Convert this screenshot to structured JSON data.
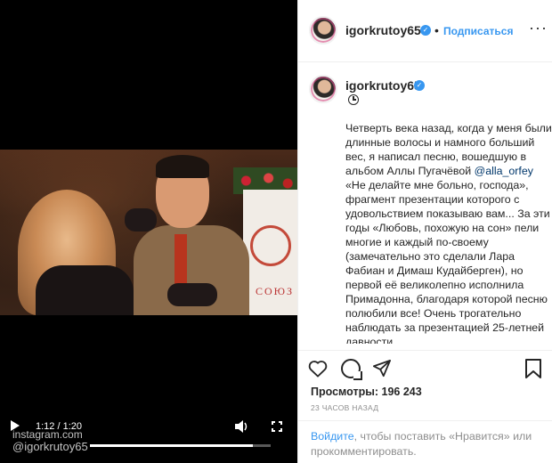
{
  "video": {
    "time_label": "1:12 / 1:20",
    "progress": 0.9,
    "watermark_site": "instagram.com",
    "watermark_handle": "@igorkrutoy65",
    "banner_text": "СОЮЗ"
  },
  "header": {
    "username": "igorkrutoy65",
    "separator": "•",
    "follow_label": "Подписаться",
    "more_label": "···"
  },
  "comment": {
    "username": "igorkrutoy65",
    "caption_before": "Четверть века назад, когда у меня были длинные волосы и намного больший вес, я написал песню, вошедшую в альбом Аллы Пугачёвой ",
    "mention": "@alla_orfey",
    "caption_after": " «Не делайте мне больно, господа», фрагмент презентации которого с удовольствием показываю вам... За эти годы «Любовь, похожую на сон» пели многие и каждый по-своему (замечательно это сделали Лара Фабиан и Димаш Кудайберген), но первой её великолепно исполнила Примадонна, благодаря которой песню полюбили все! Очень трогательно наблюдать за презентацией 25-летней давности"
  },
  "stats": {
    "views": "Просмотры: 196 243",
    "timestamp": "23 ЧАСОВ НАЗАД"
  },
  "login": {
    "link": "Войдите",
    "text": ", чтобы поставить «Нравится» или прокомментировать."
  }
}
